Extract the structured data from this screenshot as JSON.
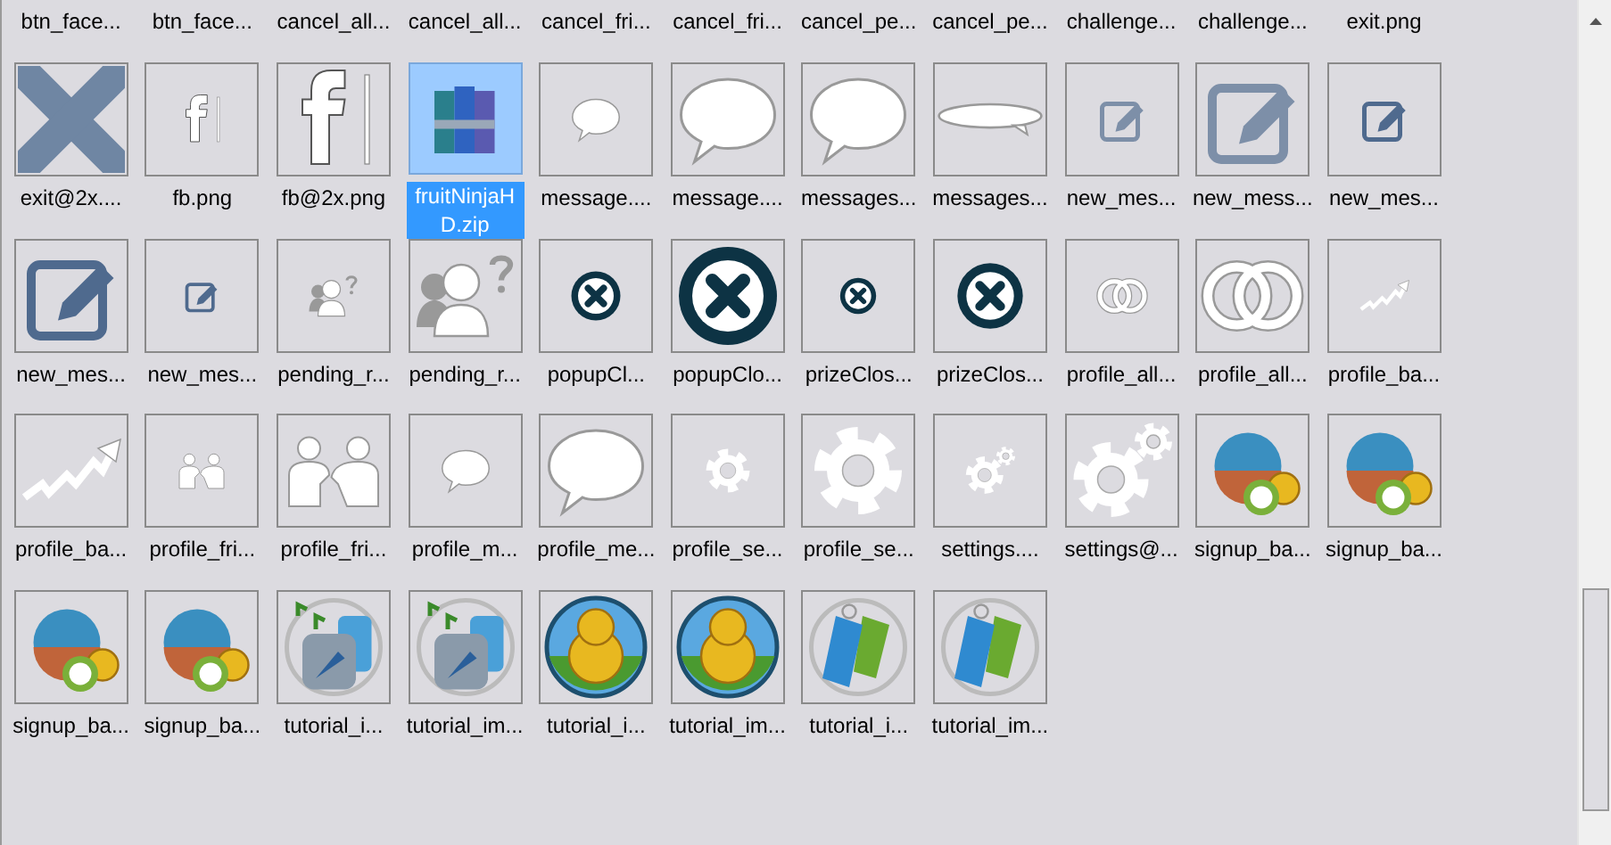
{
  "partial_row": [
    "btn_face...",
    "btn_face...",
    "cancel_all...",
    "cancel_all...",
    "cancel_fri...",
    "cancel_fri...",
    "cancel_pe...",
    "cancel_pe...",
    "challenge...",
    "challenge...",
    "exit.png"
  ],
  "files": [
    {
      "name": "exit@2x....",
      "kind": "large-cross",
      "selected": false
    },
    {
      "name": "fb.png",
      "kind": "small-letterf",
      "selected": false
    },
    {
      "name": "fb@2x.png",
      "kind": "large-letterf",
      "selected": false
    },
    {
      "name": "fruitNinjaHD.zip",
      "kind": "large-archive",
      "selected": true
    },
    {
      "name": "message....",
      "kind": "small-bubble",
      "selected": false
    },
    {
      "name": "message....",
      "kind": "large-bubble",
      "selected": false
    },
    {
      "name": "messages...",
      "kind": "large-bubble",
      "selected": false
    },
    {
      "name": "messages...",
      "kind": "large-widebubble",
      "selected": false
    },
    {
      "name": "new_mes...",
      "kind": "small-edit",
      "selected": false
    },
    {
      "name": "new_mess...",
      "kind": "large-edit",
      "selected": false
    },
    {
      "name": "new_mes...",
      "kind": "small-editdark",
      "selected": false
    },
    {
      "name": "new_mes...",
      "kind": "large-editdark",
      "selected": false
    },
    {
      "name": "new_mes...",
      "kind": "tiny-editdark",
      "selected": false
    },
    {
      "name": "pending_r...",
      "kind": "small-people",
      "selected": false
    },
    {
      "name": "pending_r...",
      "kind": "large-people",
      "selected": false
    },
    {
      "name": "popupCl...",
      "kind": "small-close",
      "selected": false
    },
    {
      "name": "popupClo...",
      "kind": "large-close",
      "selected": false
    },
    {
      "name": "prizeClos...",
      "kind": "tiny-close",
      "selected": false
    },
    {
      "name": "prizeClos...",
      "kind": "medium-close",
      "selected": false
    },
    {
      "name": "profile_all...",
      "kind": "small-rings",
      "selected": false
    },
    {
      "name": "profile_all...",
      "kind": "large-rings",
      "selected": false
    },
    {
      "name": "profile_ba...",
      "kind": "small-trend",
      "selected": false
    },
    {
      "name": "profile_ba...",
      "kind": "large-trend",
      "selected": false
    },
    {
      "name": "profile_fri...",
      "kind": "small-friends",
      "selected": false
    },
    {
      "name": "profile_fri...",
      "kind": "large-friends",
      "selected": false
    },
    {
      "name": "profile_m...",
      "kind": "small-bubble",
      "selected": false
    },
    {
      "name": "profile_me...",
      "kind": "large-bubble",
      "selected": false
    },
    {
      "name": "profile_se...",
      "kind": "small-gear",
      "selected": false
    },
    {
      "name": "profile_se...",
      "kind": "large-gear",
      "selected": false
    },
    {
      "name": "settings....",
      "kind": "small-gears",
      "selected": false
    },
    {
      "name": "settings@...",
      "kind": "large-gears",
      "selected": false
    },
    {
      "name": "signup_ba...",
      "kind": "large-coupon",
      "selected": false
    },
    {
      "name": "signup_ba...",
      "kind": "large-coupon",
      "selected": false
    },
    {
      "name": "signup_ba...",
      "kind": "large-coupon",
      "selected": false
    },
    {
      "name": "signup_ba...",
      "kind": "large-coupon",
      "selected": false
    },
    {
      "name": "tutorial_i...",
      "kind": "large-rocket",
      "selected": false
    },
    {
      "name": "tutorial_im...",
      "kind": "large-rocket",
      "selected": false
    },
    {
      "name": "tutorial_i...",
      "kind": "large-coins",
      "selected": false
    },
    {
      "name": "tutorial_im...",
      "kind": "large-coins",
      "selected": false
    },
    {
      "name": "tutorial_i...",
      "kind": "large-tags",
      "selected": false
    },
    {
      "name": "tutorial_im...",
      "kind": "large-tags",
      "selected": false
    }
  ]
}
